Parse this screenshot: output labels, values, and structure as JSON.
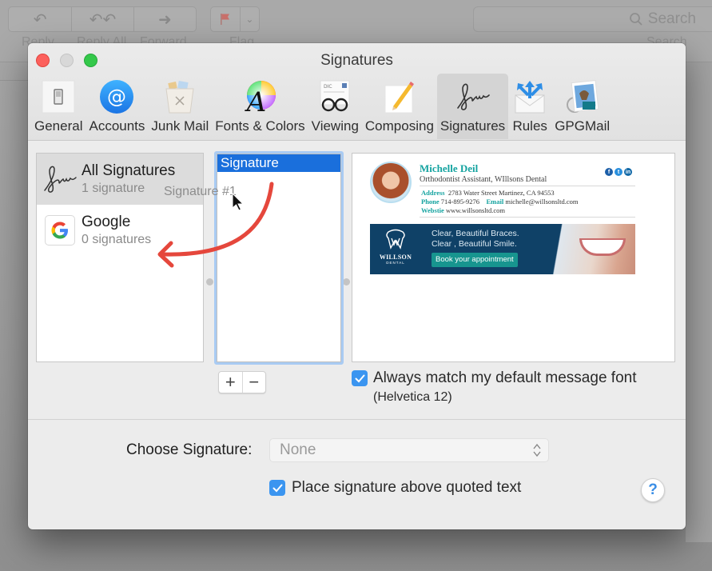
{
  "background_app": {
    "toolbar": {
      "buttons": [
        {
          "label": "Reply",
          "icon": "reply-icon"
        },
        {
          "label": "Reply All",
          "icon": "reply-all-icon"
        },
        {
          "label": "Forward",
          "icon": "forward-icon"
        },
        {
          "label": "Flag",
          "icon": "flag-icon"
        }
      ],
      "search_placeholder": "Search",
      "search_label": "Search"
    }
  },
  "window": {
    "title": "Signatures",
    "tabs": [
      {
        "label": "General",
        "icon": "switch-icon",
        "active": false
      },
      {
        "label": "Accounts",
        "icon": "at-sign-icon",
        "active": false
      },
      {
        "label": "Junk Mail",
        "icon": "trash-bin-icon",
        "active": false
      },
      {
        "label": "Fonts & Colors",
        "icon": "font-color-wheel-icon",
        "active": false
      },
      {
        "label": "Viewing",
        "icon": "glasses-icon",
        "active": false
      },
      {
        "label": "Composing",
        "icon": "pencil-paper-icon",
        "active": false
      },
      {
        "label": "Signatures",
        "icon": "signature-icon",
        "active": true
      },
      {
        "label": "Rules",
        "icon": "rules-envelope-icon",
        "active": false
      },
      {
        "label": "GPGMail",
        "icon": "gpgmail-stamp-icon",
        "active": false
      }
    ]
  },
  "accounts": [
    {
      "name": "All Signatures",
      "count": "1 signature",
      "icon": "signature-icon",
      "selected": true
    },
    {
      "name": "Google",
      "count": "0 signatures",
      "icon": "google-icon",
      "selected": false
    }
  ],
  "signatures_list": {
    "items": [
      "Signature"
    ],
    "drag_ghost": "Signature #1"
  },
  "preview": {
    "name": "Michelle Deil",
    "role": "Orthodontist Assistant, WIllsons Dental",
    "address_label": "Address",
    "address": "2783 Water Street Martinez, CA 94553",
    "phone_label": "Phone",
    "phone": "714-895-9276",
    "email_label": "Email",
    "email": "michelle@willsonsltd.com",
    "website_label": "Webstie",
    "website": "www.willsonsltd.com",
    "social": [
      "f",
      "t",
      "in"
    ],
    "banner": {
      "logo_name": "WILLSON",
      "logo_sub": "DENTAL",
      "tagline1": "Clear, Beautiful Braces.",
      "tagline2": "Clear , Beautiful Smile.",
      "cta": "Book your appointment"
    }
  },
  "controls": {
    "add": "+",
    "remove": "−",
    "match_font_label": "Always match my default message font",
    "match_font_checked": true,
    "match_font_sub": "(Helvetica 12)",
    "choose_label": "Choose Signature:",
    "choose_value": "None",
    "place_above_label": "Place signature above quoted text",
    "place_above_checked": true,
    "help": "?"
  },
  "colors": {
    "selection_blue": "#1a6fdc",
    "checkbox_blue": "#3b95f0",
    "annotation_red": "#e5473c",
    "signature_teal": "#14a3a0",
    "banner_navy": "#0f4167"
  }
}
